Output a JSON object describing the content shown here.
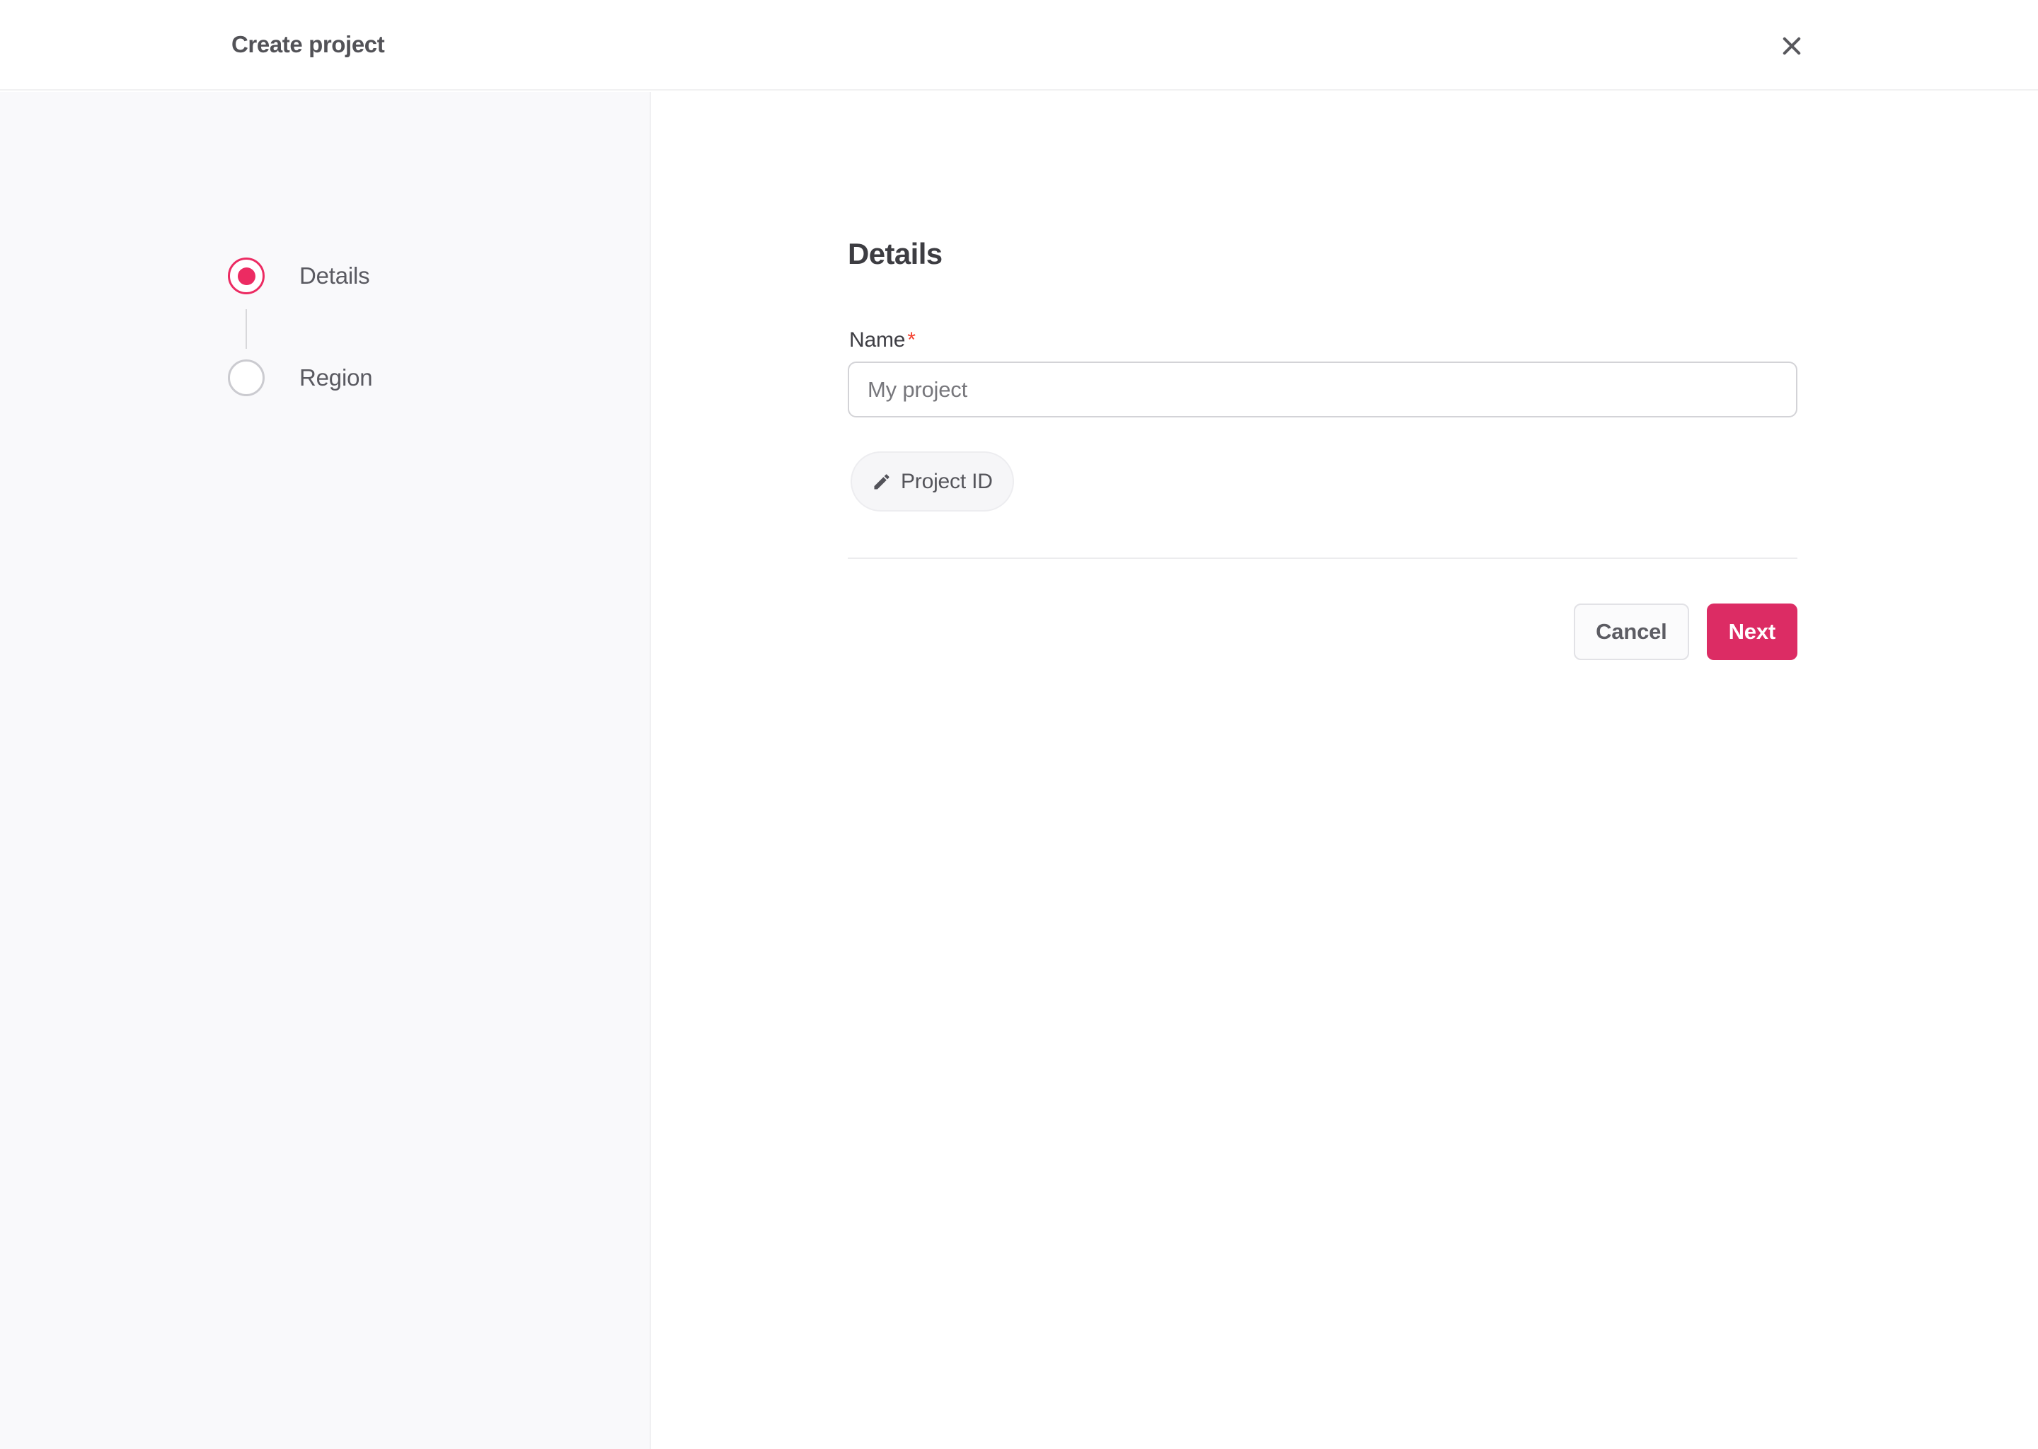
{
  "header": {
    "title": "Create project",
    "close_icon": {
      "name": "close-icon",
      "glyph": "×"
    }
  },
  "stepper": {
    "steps": [
      {
        "label": "Details",
        "state": "active"
      },
      {
        "label": "Region",
        "state": "inactive"
      }
    ]
  },
  "main": {
    "heading": "Details",
    "form": {
      "name_label": "Name",
      "required_mark": "*",
      "name_value": "",
      "name_placeholder": "My project"
    },
    "project_id_button": {
      "icon": "pencil-icon",
      "label": "Project ID"
    },
    "actions": {
      "cancel_label": "Cancel",
      "next_label": "Next"
    }
  },
  "colors": {
    "accent_pink": "#ec2b62",
    "primary_button_bg": "#dc2c64",
    "sidebar_bg": "#f9f9fb",
    "required_asterisk": "#f4402f",
    "divider": "#ececee"
  }
}
